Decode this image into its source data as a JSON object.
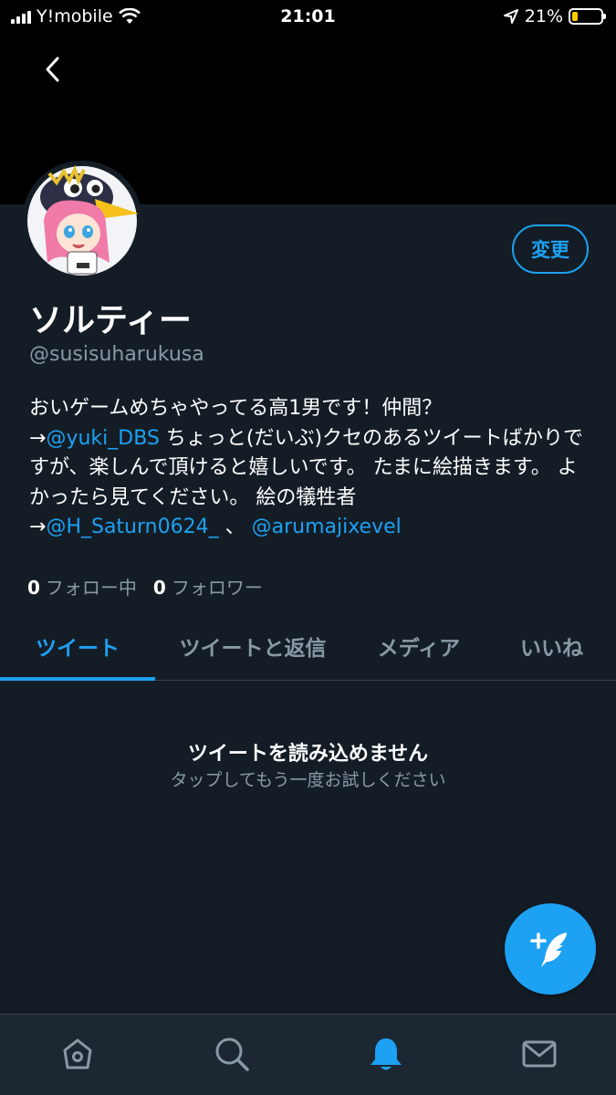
{
  "status_bar": {
    "carrier": "Y!mobile",
    "time": "21:01",
    "battery_percent": "21%",
    "battery_level": 0.21,
    "battery_color": "#ffcc00",
    "icons": [
      "signal-icon",
      "wifi-icon",
      "location-arrow-icon",
      "battery-icon"
    ]
  },
  "header": {
    "back_icon": "chevron-left-icon"
  },
  "profile": {
    "edit_label": "変更",
    "display_name": "ソルティー",
    "handle": "@susisuharukusa",
    "bio": {
      "part1": "おいゲームめちゃやってる高1男です！仲間？",
      "arrow1": "→",
      "mention1": "@yuki_DBS",
      "part2": " ちょっと(だいぶ)クセのあるツイートばかりですが、楽しんで頂けると嬉しいです。 たまに絵描きます。 よかったら見てください。 絵の犠牲者",
      "arrow2": "→",
      "mention2": "@H_Saturn0624_",
      "separator": " 、",
      "mention3": "@arumajixevel"
    },
    "following_count": "0",
    "following_label": "フォロー中",
    "followers_count": "0",
    "followers_label": "フォロワー"
  },
  "tabs": [
    {
      "label": "ツイート",
      "active": true
    },
    {
      "label": "ツイートと返信",
      "active": false
    },
    {
      "label": "メディア",
      "active": false
    },
    {
      "label": "いいね",
      "active": false
    }
  ],
  "empty_state": {
    "title": "ツイートを読み込めません",
    "subtitle": "タップしてもう一度お試しください"
  },
  "fab": {
    "icon": "compose-tweet-icon"
  },
  "bottom_nav": [
    {
      "icon": "home-icon",
      "active": false
    },
    {
      "icon": "search-icon",
      "active": false
    },
    {
      "icon": "notifications-bell-icon",
      "active": true
    },
    {
      "icon": "messages-envelope-icon",
      "active": false
    }
  ],
  "colors": {
    "background": "#141d26",
    "accent": "#1da1f2",
    "muted": "#8899a6",
    "nav_background": "#1c2732"
  }
}
